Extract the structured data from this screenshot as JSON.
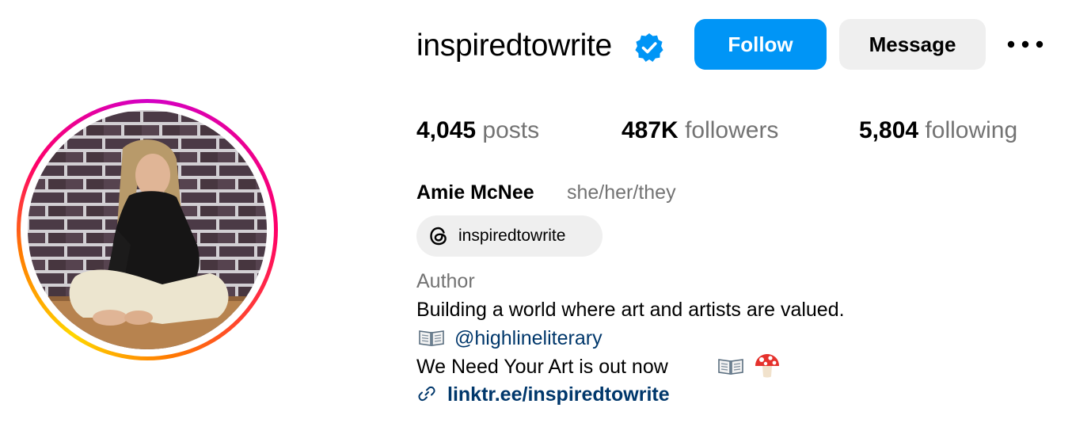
{
  "profile": {
    "username": "inspiredtowrite",
    "verified": true,
    "avatar_alt": "profile photo"
  },
  "actions": {
    "follow_label": "Follow",
    "message_label": "Message",
    "more_icon": "more-options-icon"
  },
  "stats": {
    "posts_count": "4,045",
    "posts_label": "posts",
    "followers_count": "487K",
    "followers_label": "followers",
    "following_count": "5,804",
    "following_label": "following"
  },
  "bio": {
    "full_name": "Amie McNee",
    "pronouns": "she/her/they",
    "threads_handle": "inspiredtowrite",
    "category": "Author",
    "description": "Building a world where art and artists are valued.",
    "mention": "@highlineliterary",
    "release_line": "We Need Your Art is out now",
    "link": "linktr.ee/inspiredtowrite"
  },
  "colors": {
    "accent": "#0095f6",
    "secondary_button": "#efefef",
    "muted_text": "#737373",
    "link_text": "#00376b",
    "verified_badge": "#0095f6"
  },
  "icons": [
    "verified-badge-icon",
    "more-options-icon",
    "threads-icon",
    "open-book-emoji",
    "mushroom-emoji",
    "link-icon"
  ]
}
